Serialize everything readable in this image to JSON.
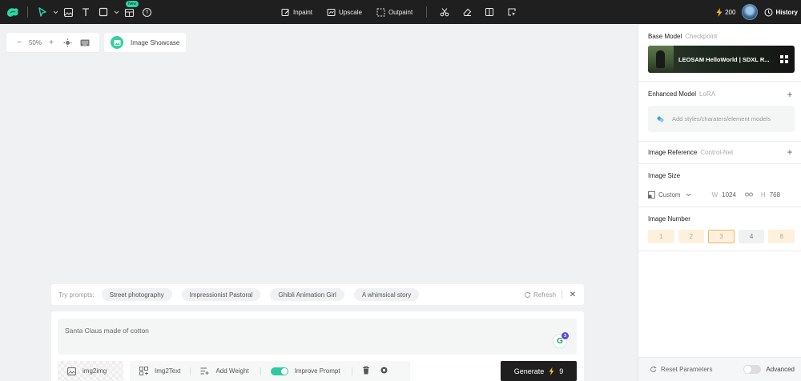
{
  "toolbar": {
    "new_badge": "New",
    "inpaint_label": "Inpaint",
    "upscale_label": "Upscale",
    "outpaint_label": "Outpaint",
    "credits": "200",
    "history_label": "History"
  },
  "canvas": {
    "zoom": "50%",
    "showcase_label": "Image Showcase"
  },
  "prompts": {
    "try_label": "Try prompts:",
    "chips": [
      "Street photography",
      "Impressionist Pastoral",
      "Ghibli Animation Girl",
      "A whimsical story"
    ],
    "refresh_label": "Refresh"
  },
  "prompt_box": {
    "text": "Santa Claus made of cotton",
    "grammarly_count": "3",
    "img2img_label": "img2img",
    "img2text_label": "Img2Text",
    "add_weight_label": "Add Weight",
    "improve_prompt_label": "Improve Prompt",
    "improve_prompt_on": true,
    "generate_label": "Generate",
    "generate_cost": "9"
  },
  "panel": {
    "base_model_title": "Base Model",
    "base_model_sub": "Checkpoint",
    "model_name": "LEOSAM HelloWorld | SDXL R...",
    "enhanced_title": "Enhanced Model",
    "enhanced_sub": "LoRA",
    "lora_placeholder": "Add styles/charaters/element models",
    "image_ref_title": "Image Reference",
    "image_ref_sub": "Control-Net",
    "size_title": "Image Size",
    "size_preset": "Custom",
    "width_label": "W",
    "width_value": "1024",
    "height_label": "H",
    "height_value": "768",
    "number_title": "Image Number",
    "numbers": [
      "1",
      "2",
      "3",
      "4",
      "8"
    ],
    "selected_number": "3",
    "reset_label": "Reset Parameters",
    "advanced_label": "Advanced"
  },
  "colors": {
    "accent": "#2ec9a0",
    "topbar": "#1f1f1f",
    "number_bg": "#fdf1de",
    "number_selected_border": "#f0b458"
  }
}
